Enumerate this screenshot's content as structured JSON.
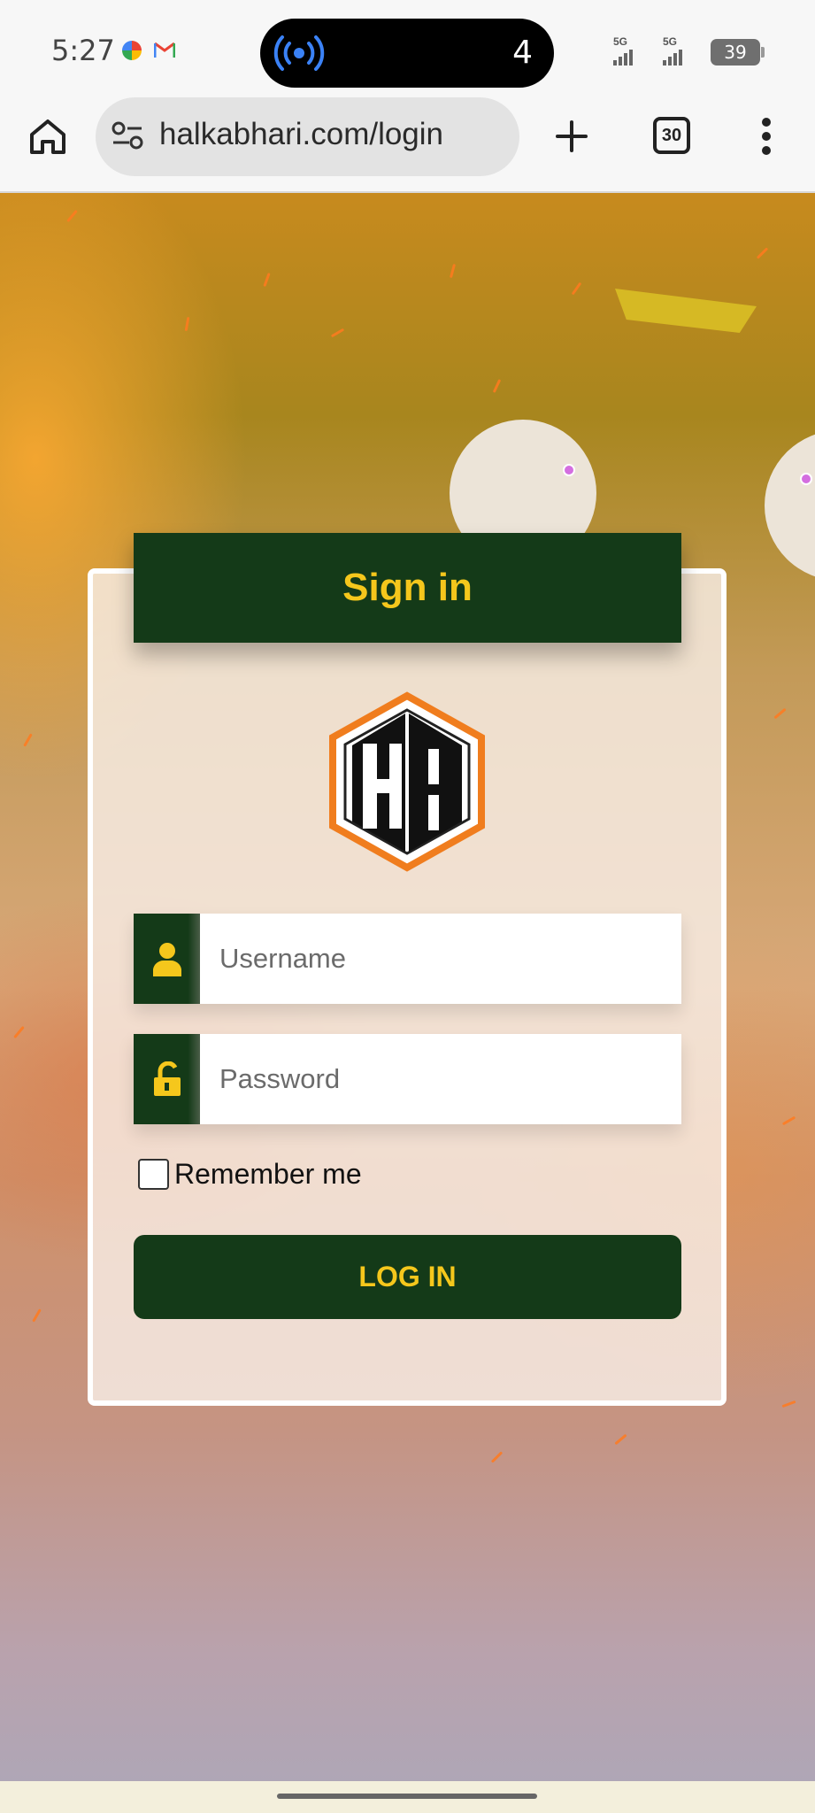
{
  "status_bar": {
    "time": "5:27",
    "island_count": "4",
    "network_1": "5G",
    "network_2": "5G",
    "battery": "39",
    "icons": [
      "photos-icon",
      "gmail-icon",
      "cast-broadcast-icon",
      "signal-icon",
      "battery-icon"
    ]
  },
  "browser": {
    "url": "halkabhari.com/login",
    "tab_count": "30",
    "icons": [
      "home-icon",
      "tune-icon",
      "plus-icon",
      "tabs-icon",
      "more-vert-icon"
    ]
  },
  "login": {
    "title": "Sign in",
    "logo_letters": "HB",
    "username_placeholder": "Username",
    "password_placeholder": "Password",
    "remember_label": "Remember me",
    "remember_checked": false,
    "submit_label": "LOG IN"
  },
  "colors": {
    "brand_green": "#143a18",
    "brand_yellow": "#f5c71c",
    "logo_orange": "#f07d1e"
  }
}
